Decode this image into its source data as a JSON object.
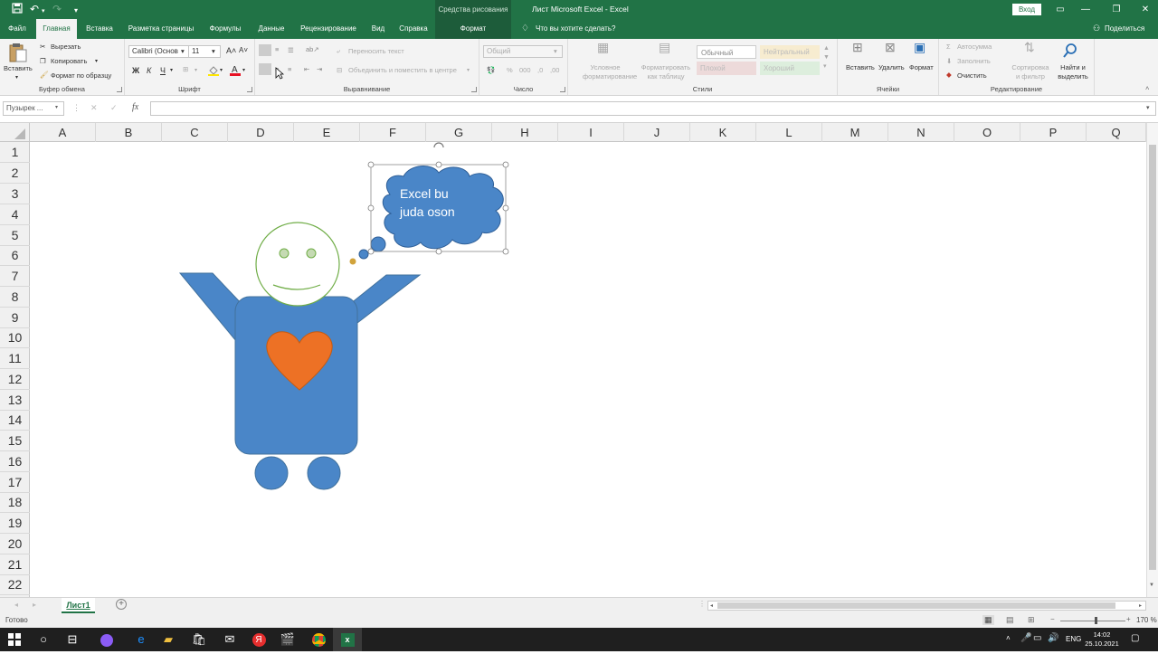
{
  "titlebar": {
    "context_group": "Средства рисования",
    "window_title": "Лист Microsoft Excel  -  Excel",
    "login_button": "Вход"
  },
  "tabs": [
    "Файл",
    "Главная",
    "Вставка",
    "Разметка страницы",
    "Формулы",
    "Данные",
    "Рецензирование",
    "Вид",
    "Справка",
    "Формат"
  ],
  "tell_me": "Что вы хотите сделать?",
  "share": "Поделиться",
  "ribbon": {
    "clipboard": {
      "paste": "Вставить",
      "cut": "Вырезать",
      "copy": "Копировать",
      "format_painter": "Формат по образцу",
      "label": "Буфер обмена"
    },
    "font": {
      "name": "Calibri (Основ",
      "size": "11",
      "bold": "Ж",
      "italic": "К",
      "underline": "Ч",
      "label": "Шрифт"
    },
    "alignment": {
      "wrap": "Переносить текст",
      "merge": "Объединить и поместить в центре",
      "label": "Выравнивание"
    },
    "number": {
      "format": "Общий",
      "label": "Число"
    },
    "styles": {
      "conditional": "Условное форматирование",
      "as_table": "Форматировать как таблицу",
      "normal": "Обычный",
      "neutral": "Нейтральный",
      "bad": "Плохой",
      "good": "Хороший",
      "label": "Стили"
    },
    "cells": {
      "insert": "Вставить",
      "delete": "Удалить",
      "format": "Формат",
      "label": "Ячейки"
    },
    "editing": {
      "autosum": "Автосумма",
      "fill": "Заполнить",
      "clear": "Очистить",
      "sort": "Сортировка и фильтр",
      "find": "Найти и выделить",
      "label": "Редактирование"
    }
  },
  "namebox": "Пузырек ...",
  "fx": "fx",
  "columns": [
    "A",
    "B",
    "C",
    "D",
    "E",
    "F",
    "G",
    "H",
    "I",
    "J",
    "K",
    "L",
    "M",
    "N",
    "O",
    "P",
    "Q"
  ],
  "rows": [
    "1",
    "2",
    "3",
    "4",
    "5",
    "6",
    "7",
    "8",
    "9",
    "10",
    "11",
    "12",
    "13",
    "14",
    "15",
    "16",
    "17",
    "18",
    "19",
    "20",
    "21",
    "22"
  ],
  "bubble": {
    "line1": "Excel bu",
    "line2": "juda oson"
  },
  "sheet_tab": "Лист1",
  "status": {
    "ready": "Готово",
    "zoom": "170 %"
  },
  "taskbar": {
    "lang": "ENG",
    "time": "14:02",
    "date": "25.10.2021"
  },
  "colors": {
    "excel_green": "#217346",
    "shape_blue": "#4a86c8",
    "heart": "#ed7125",
    "face_outline": "#70ad47"
  }
}
